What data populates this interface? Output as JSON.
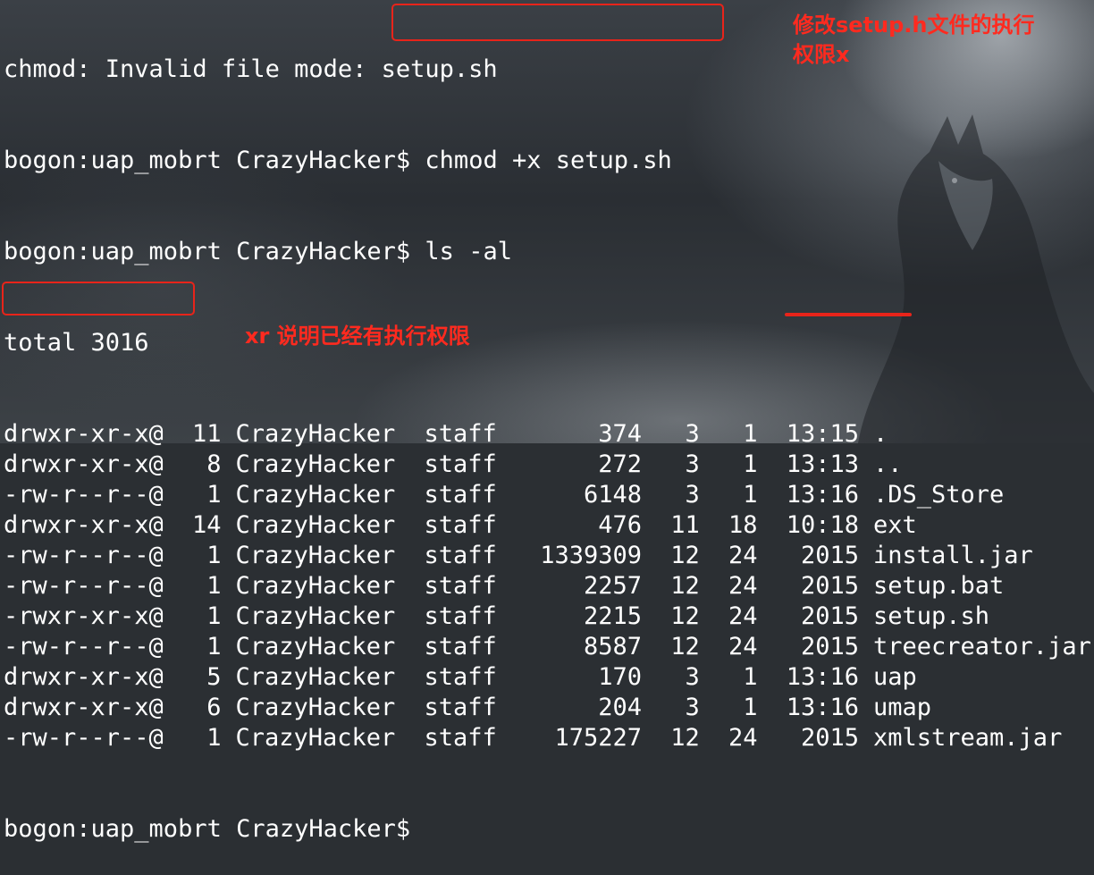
{
  "terminal": {
    "top_partial": "chmod: Invalid file mode: setup.sh",
    "prompt": "bogon:uap_mobrt CrazyHacker$",
    "cmd1": "chmod +x setup.sh",
    "cmd2": "ls -al",
    "total": "total 3016",
    "files": [
      [
        "drwxr-xr-x@",
        "11",
        "CrazyHacker",
        "staff",
        "374",
        "3",
        "1",
        "13:15",
        "."
      ],
      [
        "drwxr-xr-x@",
        "8",
        "CrazyHacker",
        "staff",
        "272",
        "3",
        "1",
        "13:13",
        ".."
      ],
      [
        "-rw-r--r--@",
        "1",
        "CrazyHacker",
        "staff",
        "6148",
        "3",
        "1",
        "13:16",
        ".DS_Store"
      ],
      [
        "drwxr-xr-x@",
        "14",
        "CrazyHacker",
        "staff",
        "476",
        "11",
        "18",
        "10:18",
        "ext"
      ],
      [
        "-rw-r--r--@",
        "1",
        "CrazyHacker",
        "staff",
        "1339309",
        "12",
        "24",
        "2015",
        "install.jar"
      ],
      [
        "-rw-r--r--@",
        "1",
        "CrazyHacker",
        "staff",
        "2257",
        "12",
        "24",
        "2015",
        "setup.bat"
      ],
      [
        "-rwxr-xr-x@",
        "1",
        "CrazyHacker",
        "staff",
        "2215",
        "12",
        "24",
        "2015",
        "setup.sh"
      ],
      [
        "-rw-r--r--@",
        "1",
        "CrazyHacker",
        "staff",
        "8587",
        "12",
        "24",
        "2015",
        "treecreator.jar"
      ],
      [
        "drwxr-xr-x@",
        "5",
        "CrazyHacker",
        "staff",
        "170",
        "3",
        "1",
        "13:16",
        "uap"
      ],
      [
        "drwxr-xr-x@",
        "6",
        "CrazyHacker",
        "staff",
        "204",
        "3",
        "1",
        "13:16",
        "umap"
      ],
      [
        "-rw-r--r--@",
        "1",
        "CrazyHacker",
        "staff",
        "175227",
        "12",
        "24",
        "2015",
        "xmlstream.jar"
      ]
    ],
    "bottom_partial": "bogon:uap_mobrt CrazyHacker$ "
  },
  "annotations": {
    "note_chmod": "修改setup.h文件的执行权限x",
    "note_xr": "xr 说明已经有执行权限"
  },
  "colors": {
    "text": "#ffffff",
    "annotation": "#e8241a"
  }
}
